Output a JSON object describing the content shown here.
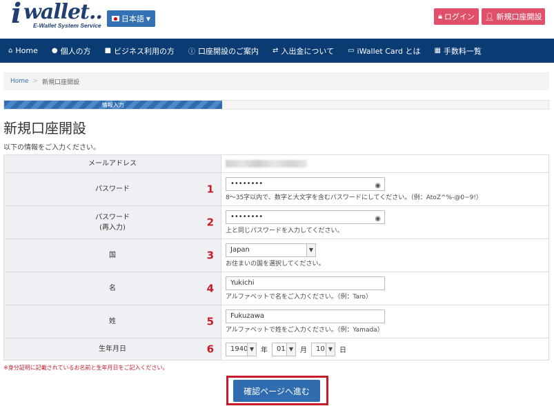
{
  "header": {
    "logo_text": "wallet..",
    "logo_letter": "i",
    "logo_tagline": "E-Wallet System Service",
    "language": "日本語",
    "login": "ログイン",
    "signup": "新規口座開設"
  },
  "nav": {
    "items": [
      {
        "label": "Home",
        "icon": "home-icon"
      },
      {
        "label": "個人の方",
        "icon": "user-icon"
      },
      {
        "label": "ビジネス利用の方",
        "icon": "briefcase-icon"
      },
      {
        "label": "口座開設のご案内",
        "icon": "info-icon"
      },
      {
        "label": "入出金について",
        "icon": "exchange-icon"
      },
      {
        "label": "iWallet Card とは",
        "icon": "card-icon"
      },
      {
        "label": "手数料一覧",
        "icon": "calculator-icon"
      }
    ]
  },
  "breadcrumb": {
    "home": "Home",
    "separator": ">",
    "current": "新規口座開設"
  },
  "progress": {
    "label": "情報入力",
    "fraction": 0.4
  },
  "page": {
    "title": "新規口座開設",
    "subtitle": "以下の情報をご入力ください。"
  },
  "form": {
    "email": {
      "label": "メールアドレス"
    },
    "password": {
      "label": "パスワード",
      "number": "1",
      "value": "••••••••",
      "help": "8〜35字以内で、数字と大文字を含むパスワードにしてください。（例：AtoZ^%-@0~9!）"
    },
    "password_confirm": {
      "label1": "パスワード",
      "label2": "(再入力)",
      "number": "2",
      "value": "••••••••",
      "help": "上と同じパスワードを入力してください。"
    },
    "country": {
      "label": "国",
      "number": "3",
      "value": "Japan",
      "help": "お住まいの国を選択してください。"
    },
    "first_name": {
      "label": "名",
      "number": "4",
      "value": "Yukichi",
      "help": "アルファベットで名をご入力ください。（例：Taro）"
    },
    "last_name": {
      "label": "姓",
      "number": "5",
      "value": "Fukuzawa",
      "help": "アルファベットで姓をご入力ください。（例：Yamada）"
    },
    "birthdate": {
      "label": "生年月日",
      "number": "6",
      "year": "1940",
      "year_unit": "年",
      "month": "01",
      "month_unit": "月",
      "day": "10",
      "day_unit": "日"
    }
  },
  "note": "※身分証明に記載されているお名前と生年月日をご記入ください。",
  "submit": "確認ページへ進む",
  "colors": {
    "nav_bg": "#0b3b73",
    "accent_blue": "#2f6db0",
    "pink": "#e0506a",
    "highlight_red": "#c71a2b"
  }
}
